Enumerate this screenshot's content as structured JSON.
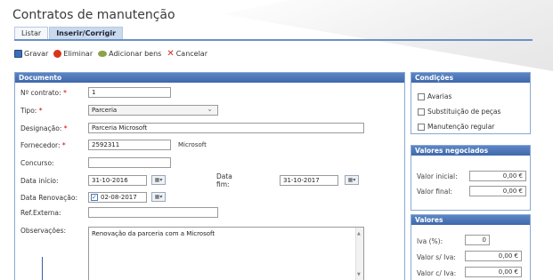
{
  "page": {
    "title": "Contratos de manutenção"
  },
  "tabs": [
    {
      "label": "Listar",
      "active": false
    },
    {
      "label": "Inserir/Corrigir",
      "active": true
    }
  ],
  "toolbar": {
    "save_label": "Gravar",
    "delete_label": "Eliminar",
    "add_assets_label": "Adicionar bens",
    "cancel_label": "Cancelar"
  },
  "document": {
    "header": "Documento",
    "contract_no": {
      "label": "Nº contrato:",
      "required": "*",
      "value": "1"
    },
    "type": {
      "label": "Tipo:",
      "required": "*",
      "value": "Parceria"
    },
    "designation": {
      "label": "Designação:",
      "required": "*",
      "value": "Parceria Microsoft"
    },
    "supplier": {
      "label": "Fornecedor:",
      "required": "*",
      "code": "2592311",
      "name": "Microsoft"
    },
    "tender": {
      "label": "Concurso:",
      "value": ""
    },
    "start_date": {
      "label": "Data início:",
      "value": "31-10-2016"
    },
    "end_date": {
      "label": "Data fim:",
      "value": "31-10-2017"
    },
    "renewal_date": {
      "label": "Data Renovação:",
      "value": "02-08-2017",
      "checked": true
    },
    "ext_ref": {
      "label": "Ref.Externa:",
      "value": ""
    },
    "notes": {
      "label": "Observações:",
      "value": "Renovação da parceria com a Microsoft"
    }
  },
  "conditions": {
    "header": "Condições",
    "items": [
      {
        "label": "Avarias",
        "checked": false
      },
      {
        "label": "Substituição de peças",
        "checked": false
      },
      {
        "label": "Manutenção regular",
        "checked": false
      }
    ]
  },
  "negotiated": {
    "header": "Valores negociados",
    "initial": {
      "label": "Valor inicial:",
      "value": "0,00 €"
    },
    "final": {
      "label": "Valor final:",
      "value": "0,00 €"
    }
  },
  "values": {
    "header": "Valores",
    "vat": {
      "label": "Iva (%):",
      "value": "0"
    },
    "no_vat": {
      "label": "Valor s/ Iva:",
      "value": "0,00 €"
    },
    "with_vat": {
      "label": "Valor c/ Iva:",
      "value": "0,00 €"
    }
  },
  "colors": {
    "panel_header": "#4a74b5",
    "tab_active": "#c9d9ee",
    "required": "#cc0000"
  }
}
